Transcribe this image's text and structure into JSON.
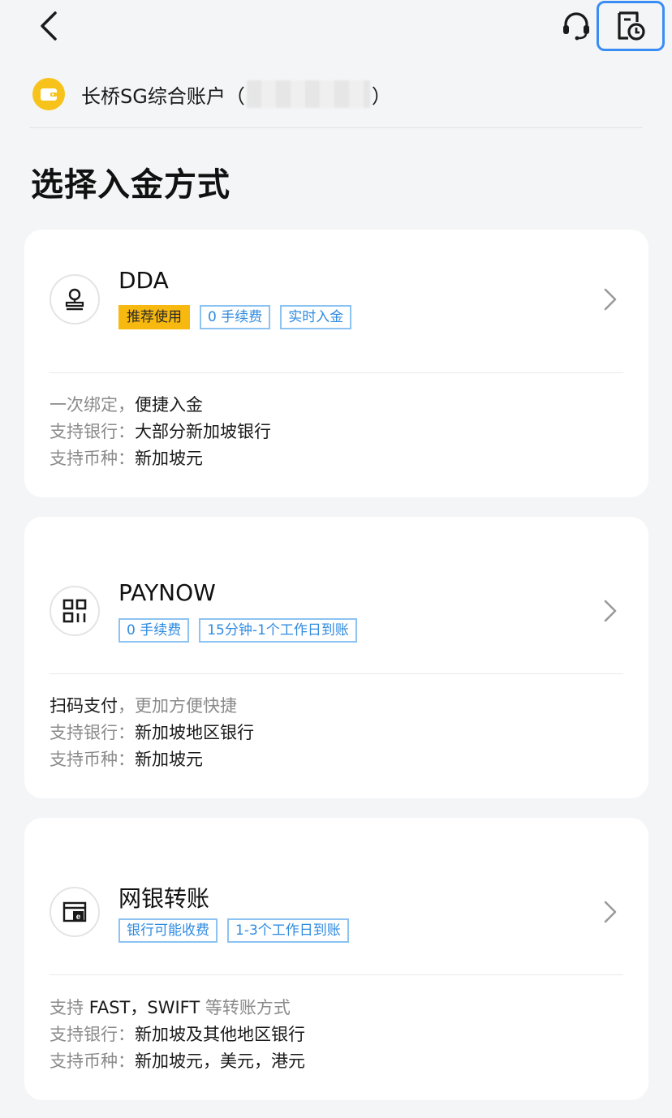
{
  "header": {
    "back_icon": "chevron-left-icon",
    "support_icon": "headset-icon",
    "history_icon": "records-clock-icon"
  },
  "account": {
    "icon": "wallet-icon",
    "name": "长桥SG综合账户",
    "open_paren": "（",
    "close_paren": "）"
  },
  "page_title": "选择入金方式",
  "methods": [
    {
      "icon": "stamp-icon",
      "title": "DDA",
      "tags": [
        "推荐使用",
        "0 手续费",
        "实时入金"
      ],
      "desc": [
        {
          "label": "一次绑定，",
          "value": "便捷入金"
        },
        {
          "label": "支持银行：",
          "value": "大部分新加坡银行"
        },
        {
          "label": "支持币种：",
          "value": "新加坡元"
        }
      ]
    },
    {
      "icon": "qr-code-icon",
      "title": "PAYNOW",
      "tags": [
        "0 手续费",
        "15分钟-1个工作日到账"
      ],
      "desc": [
        {
          "label": "扫码支付",
          "value": "，更加方便快捷"
        },
        {
          "label": "支持银行：",
          "value": "新加坡地区银行"
        },
        {
          "label": "支持币种：",
          "value": "新加坡元"
        }
      ]
    },
    {
      "icon": "online-banking-icon",
      "title": "网银转账",
      "tags": [
        "银行可能收费",
        "1-3个工作日到账"
      ],
      "desc": [
        {
          "label": "支持 ",
          "value": "FAST，SWIFT",
          "suffix": " 等转账方式"
        },
        {
          "label": "支持银行：",
          "value": "新加坡及其他地区银行"
        },
        {
          "label": "支持币种：",
          "value": "新加坡元，美元，港元"
        }
      ]
    }
  ],
  "colors": {
    "background": "#f4f5f6",
    "accent_blue": "#2f8be0",
    "tag_border": "#8cc3f1",
    "recommend_yellow": "#f7b80f",
    "wallet_yellow": "#f7c31b",
    "highlight_border": "#3b8df5"
  }
}
